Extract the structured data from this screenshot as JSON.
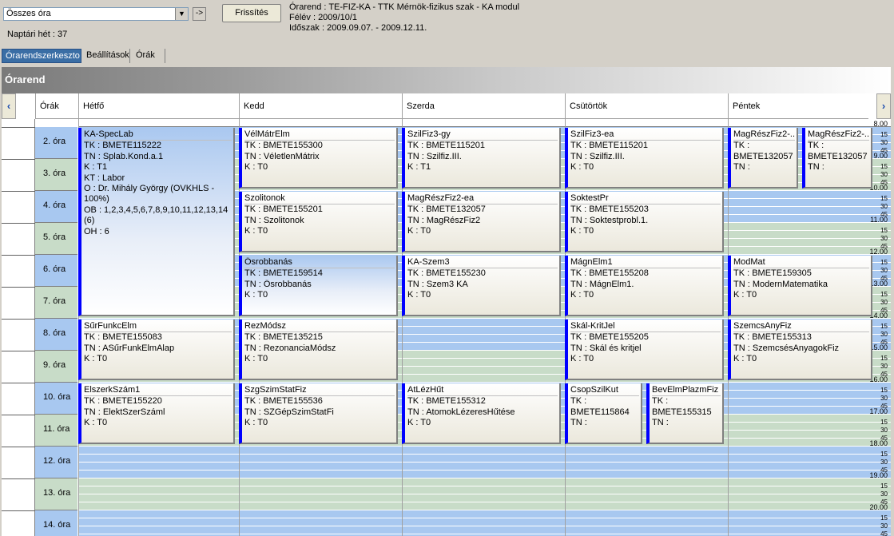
{
  "toolbar": {
    "filter_value": "Összes óra",
    "dropdown_icon": "▼",
    "go_label": "->",
    "refresh_label": "Frissítés",
    "week_label": "Naptári hét : 37",
    "info": [
      "Órarend : TE-FIZ-KA - TTK Mérnök-fizikus szak - KA modul",
      "Félév : 2009/10/1",
      "Időszak : 2009.09.07. - 2009.12.11."
    ]
  },
  "tabs": [
    "Órarendszerkeszto",
    "Beállítások",
    "Órák"
  ],
  "panel_title": "Órarend",
  "grid": {
    "nav_left": "‹",
    "nav_right": "›",
    "col_slots": "Órák",
    "days": [
      "Hétfő",
      "Kedd",
      "Szerda",
      "Csütörtök",
      "Péntek"
    ],
    "hours": [
      "8.00",
      "9.00",
      "10.00",
      "11.00",
      "12.00",
      "13.00",
      "14.00",
      "15.00",
      "16.00",
      "17.00",
      "18.00",
      "19.00",
      "20.00"
    ],
    "minute_ticks": [
      "15",
      "30",
      "45"
    ],
    "slots": [
      "2. óra",
      "3. óra",
      "4. óra",
      "5. óra",
      "6. óra",
      "7. óra",
      "8. óra",
      "9. óra",
      "10. óra",
      "11. óra",
      "12. óra",
      "13. óra",
      "14. óra"
    ]
  },
  "colors": {
    "slot_blue": "#a8c8f0",
    "slot_green": "#c8dcc8",
    "event_border": "#0000ff",
    "tab_active": "#3a6ea5"
  },
  "events": [
    {
      "day": 0,
      "sub": 0,
      "subs": 1,
      "start": 0,
      "len": 6,
      "sel": true,
      "long": true,
      "lines": [
        "KA-SpecLab",
        "TK : BMETE115222",
        "TN : Splab.Kond.a.1",
        "K : T1",
        "KT : Labor",
        "O : Dr. Mihály György (OVKHLS - 100%)",
        "OB : 1,2,3,4,5,6,7,8,9,10,11,12,13,14 (6)",
        "OH : 6"
      ]
    },
    {
      "day": 1,
      "sub": 0,
      "subs": 1,
      "start": 0,
      "len": 2,
      "lines": [
        "VélMátrElm",
        "TK : BMETE155300",
        "TN : VéletlenMátrix",
        "K : T0"
      ]
    },
    {
      "day": 2,
      "sub": 0,
      "subs": 1,
      "start": 0,
      "len": 2,
      "lines": [
        "SzilFiz3-gy",
        "TK : BMETE115201",
        "TN : Szilfiz.III.",
        "K : T1"
      ]
    },
    {
      "day": 3,
      "sub": 0,
      "subs": 1,
      "start": 0,
      "len": 2,
      "lines": [
        "SzilFiz3-ea",
        "TK : BMETE115201",
        "TN : Szilfiz.III.",
        "K : T0"
      ]
    },
    {
      "day": 4,
      "sub": 0,
      "subs": 2,
      "start": 0,
      "len": 2,
      "lines": [
        "MagRészFiz2-...",
        "TK :",
        "BMETE132057",
        "TN :"
      ]
    },
    {
      "day": 4,
      "sub": 1,
      "subs": 2,
      "start": 0,
      "len": 2,
      "lines": [
        "MagRészFiz2-...",
        "TK :",
        "BMETE132057",
        "TN :"
      ]
    },
    {
      "day": 1,
      "sub": 0,
      "subs": 1,
      "start": 2,
      "len": 2,
      "lines": [
        "Szolitonok",
        "TK : BMETE155201",
        "TN : Szolitonok",
        "K : T0"
      ]
    },
    {
      "day": 2,
      "sub": 0,
      "subs": 1,
      "start": 2,
      "len": 2,
      "lines": [
        "MagRészFiz2-ea",
        "TK : BMETE132057",
        "TN : MagRészFiz2",
        "K : T0"
      ]
    },
    {
      "day": 3,
      "sub": 0,
      "subs": 1,
      "start": 2,
      "len": 2,
      "lines": [
        "SoktestPr",
        "TK : BMETE155203",
        "TN : Soktestprobl.1.",
        "K : T0"
      ]
    },
    {
      "day": 1,
      "sub": 0,
      "subs": 1,
      "start": 4,
      "len": 2,
      "sel": true,
      "lines": [
        "Ősrobbanás",
        "TK : BMETE159514",
        "TN : Ősrobbanás",
        "K : T0"
      ]
    },
    {
      "day": 2,
      "sub": 0,
      "subs": 1,
      "start": 4,
      "len": 2,
      "lines": [
        "KA-Szem3",
        "TK : BMETE155230",
        "TN : Szem3 KA",
        "K : T0"
      ]
    },
    {
      "day": 3,
      "sub": 0,
      "subs": 1,
      "start": 4,
      "len": 2,
      "lines": [
        "MágnElm1",
        "TK : BMETE155208",
        "TN : MágnElm1.",
        "K : T0"
      ]
    },
    {
      "day": 4,
      "sub": 0,
      "subs": 1,
      "start": 4,
      "len": 2,
      "lines": [
        "ModMat",
        "TK : BMETE159305",
        "TN : ModernMatematika",
        "K : T0"
      ]
    },
    {
      "day": 0,
      "sub": 0,
      "subs": 1,
      "start": 6,
      "len": 2,
      "lines": [
        "SűrFunkcElm",
        "TK : BMETE155083",
        "TN : ASűrFunkElmAlap",
        "K : T0"
      ]
    },
    {
      "day": 1,
      "sub": 0,
      "subs": 1,
      "start": 6,
      "len": 2,
      "lines": [
        "RezMódsz",
        "TK : BMETE135215",
        "TN : RezonanciaMódsz",
        "K : T0"
      ]
    },
    {
      "day": 3,
      "sub": 0,
      "subs": 1,
      "start": 6,
      "len": 2,
      "lines": [
        "Skál-KritJel",
        "TK : BMETE155205",
        "TN : Skál és kritjel",
        "K : T0"
      ]
    },
    {
      "day": 4,
      "sub": 0,
      "subs": 1,
      "start": 6,
      "len": 2,
      "lines": [
        "SzemcsAnyFiz",
        "TK : BMETE155313",
        "TN : SzemcsésAnyagokFiz",
        "K : T0"
      ]
    },
    {
      "day": 0,
      "sub": 0,
      "subs": 1,
      "start": 8,
      "len": 2,
      "lines": [
        "ElszerkSzám1",
        "TK : BMETE155220",
        "TN : ElektSzerSzáml",
        "K : T0"
      ]
    },
    {
      "day": 1,
      "sub": 0,
      "subs": 1,
      "start": 8,
      "len": 2,
      "lines": [
        "SzgSzimStatFiz",
        "TK : BMETE155536",
        "TN : SZGépSzimStatFi",
        "K : T0"
      ]
    },
    {
      "day": 2,
      "sub": 0,
      "subs": 1,
      "start": 8,
      "len": 2,
      "lines": [
        "AtLézHűt",
        "TK : BMETE155312",
        "TN : AtomokLézeresHűtése",
        "K : T0"
      ]
    },
    {
      "day": 3,
      "sub": 0,
      "subs": 2,
      "start": 8,
      "len": 2,
      "lines": [
        "CsopSzilKut",
        "TK :",
        "BMETE115864",
        "TN :"
      ]
    },
    {
      "day": 3,
      "sub": 1,
      "subs": 2,
      "start": 8,
      "len": 2,
      "lines": [
        "BevElmPlazmFiz",
        "TK :",
        "BMETE155315",
        "TN :"
      ]
    }
  ]
}
